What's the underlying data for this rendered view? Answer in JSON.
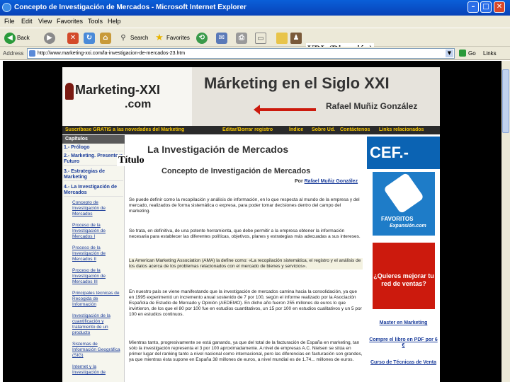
{
  "window": {
    "title": "Concepto de Investigación de Mercados - Microsoft Internet Explorer",
    "min": "–",
    "max": "□",
    "close": "✕"
  },
  "menu": [
    "File",
    "Edit",
    "View",
    "Favorites",
    "Tools",
    "Help"
  ],
  "toolbar": {
    "back": "Back",
    "search": "Search",
    "favorites": "Favorites"
  },
  "address": {
    "label": "Address",
    "url": "http://www.marketing-xxi.com/la-investigacion-de-mercados-23.htm",
    "go": "Go",
    "links": "Links"
  },
  "annotations": {
    "url": "URL (Dirección)",
    "title": "Título"
  },
  "site": {
    "logo": "Marketing-XXI",
    "logo_sub": ".com",
    "banner_title": "Márketing en el Siglo XXI",
    "author": "Rafael Muñiz González",
    "nav": [
      "Suscríbase GRATIS a las novedades del Marketing",
      "Editar/Borrar registro",
      "Índice",
      "Sobre Ud.",
      "Contáctenos",
      "Links relacionados"
    ]
  },
  "sidebar": {
    "header": "Capítulos",
    "chapters": [
      "1.- Prólogo",
      "2.- Marketing. Presente y Futuro",
      "3.- Estrategias de Marketing",
      "4.- La Investigación de Mercados"
    ],
    "subitems": [
      "Concepto de Investigación de Mercados",
      "Proceso de la Investigación de Mercados I",
      "Proceso de la Investigación de Mercados II",
      "Proceso de la Investigación de Mercados III",
      "Principales técnicas de Recogida de Información",
      "Investigación de la cuantificación y tratamiento de un producto",
      "Sistemas de Información Geográfica (SIG)",
      "Internet y la Investigación de"
    ]
  },
  "article": {
    "chapter_title": "La Investigación de Mercados",
    "section_title": "Concepto de Investigación de Mercados",
    "by_label": "Por",
    "by_author": "Rafael Muñiz González",
    "paragraphs": [
      "Se puede definir como la recopilación y análisis de información, en lo que respecta al mundo de la empresa y del mercado, realizados de forma sistemática o expresa, para poder tomar decisiones dentro del campo del marketing.",
      "Se trata, en definitiva, de una potente herramienta, que debe permitir a la empresa obtener la información necesaria para establecer las diferentes políticas, objetivos, planes y estrategias más adecuadas a sus intereses.",
      "La American Marketing Association (AMA) la define como: «La recopilación sistemática, el registro y el análisis de los datos acerca de los problemas relacionados con el mercado de bienes y servicios».",
      "En nuestro país se viene manifestando que la investigación de mercados camina hacia la consolidación, ya que en 1995 experimentó un incremento anual sostenido de 7 por 100, según el informe realizado por la Asociación Española de Estudio de Mercado y Opinión (AEDEMO). En dicho año fueron 255 millones de euros lo que invirtieron, de los que el 80 por 100 fue en estudios cuantitativos, un 15 por 100 en estudios cualitativos y un 5 por 100 en estudios continuos.",
      "Mientras tanto, progresivamente se está ganando, ya que del total de la facturación de España en marketing, tan sólo la investigación representa el 3 por 100 aproximadamente. A nivel de empresas A.C. Nielsen se sitúa en primer lugar del ranking tanto a nivel nacional como internacional, pero las diferencias en facturación son grandes, ya que mientras ésta supone en España 38 millones de euros, a nivel mundial es de 1.74... millones de euros."
    ]
  },
  "right": {
    "cef": "CEF.-",
    "fav_title": "FAVORITOS",
    "fav_sub": "Expansión.com",
    "promo": "¿Quieres mejorar tu red de ventas?",
    "links": [
      "Master en Marketing",
      "Compre el libro en PDF por 6 €",
      "Curso de Técnicas de Venta"
    ]
  }
}
